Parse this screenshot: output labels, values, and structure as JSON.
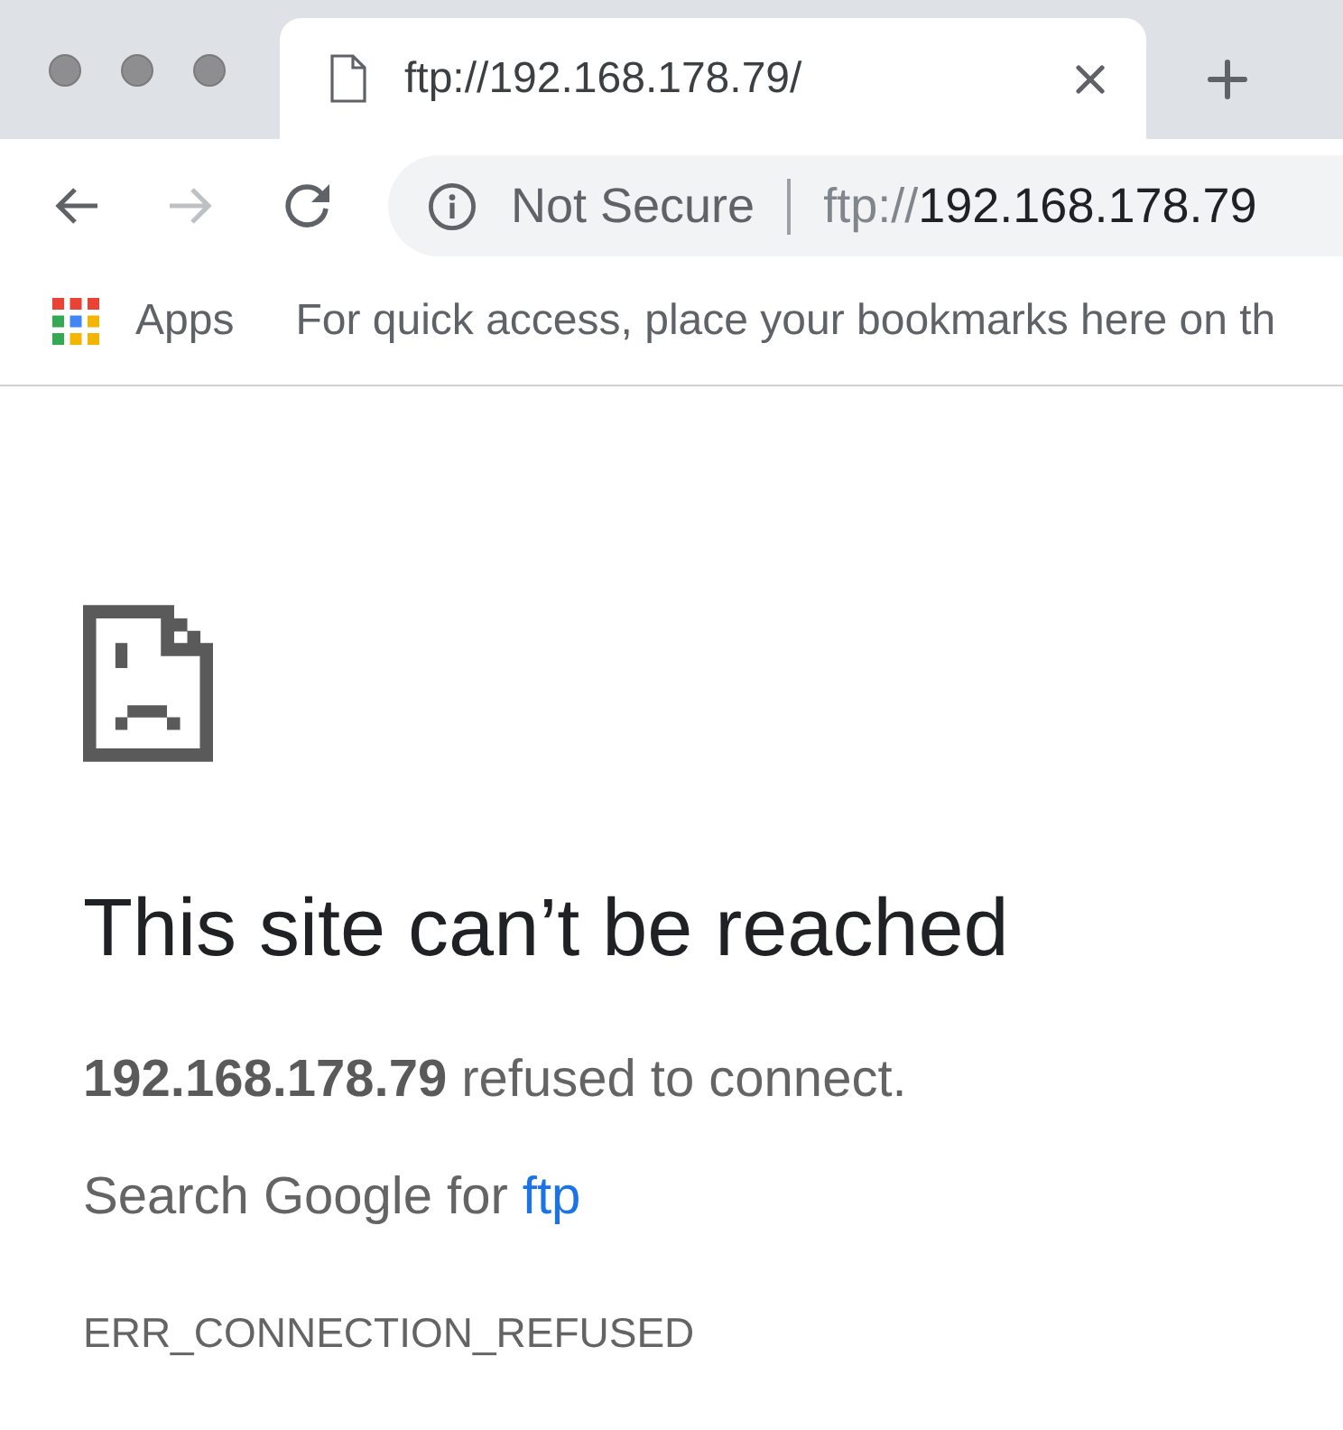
{
  "tabs": [
    {
      "title": "ftp://192.168.178.79/",
      "selected": true
    }
  ],
  "toolbar": {
    "buttons": [
      {
        "kind": "back",
        "disabled": false
      },
      {
        "kind": "forward",
        "disabled": true
      },
      {
        "kind": "reload",
        "disabled": false
      }
    ]
  },
  "address_bar": {
    "security_label": "Not Secure",
    "url_scheme": "ftp://",
    "url_host": "192.168.178.79"
  },
  "bookmarks_bar": {
    "apps_label": "Apps",
    "hint": "For quick access, place your bookmarks here on th"
  },
  "error_page": {
    "heading": "This site can’t be reached",
    "message": "**192.168.178.79** refused to connect.",
    "suggestion": "Search Google for",
    "suggestion_link": "ftp",
    "error_code": "ERR_CONNECTION_REFUSED"
  }
}
